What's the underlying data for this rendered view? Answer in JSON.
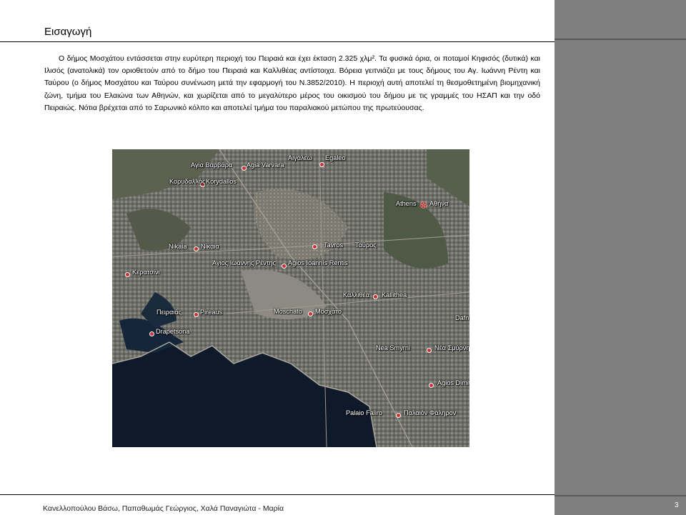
{
  "title": "Εισαγωγή",
  "intro_text": "Ο δήμος Μοσχάτου εντάσσεται στην ευρύτερη περιοχή του Πειραιά και έχει έκταση 2.325 χλμ². Τα φυσικά όρια, οι ποταμοί Κηφισός (δυτικά) και Ιλισός (ανατολικά) τον οριοθετούν από το δήμο του Πειραιά και Καλλιθέας αντίστοιχα. Βόρεια γειτνιάζει με τους δήμους του Αγ. Ιωάννη Ρέντη και Ταύρου (ο δήμος Μοσχάτου και Ταύρου συνένωση μετά την εφαρμογή του Ν.3852/2010). Η περιοχή αυτή αποτελεί τη θεσμοθετημένη βιομηχανική ζώνη, τμήμα του Ελαιώνα των Αθηνών, και χωρίζεται από το μεγαλύτερο μέρος του οικισμού του δήμου με τις γραμμές του ΗΣΑΠ και την οδό Πειραιώς. Νότια βρέχεται από το Σαρωνικό κόλπο και αποτελεί τμήμα του παραλιακού μετώπου της πρωτεύουσας.",
  "map": {
    "labels": {
      "aigaleo": "Αιγάλεω",
      "egaleo": "Egaleo",
      "agia_varvara_gr": "Αγία Βαρβάρα",
      "agia_varvara_en": "Agia Varvara",
      "korydallos_gr": "Κορυδαλλός",
      "korydallos_en": "Korydallos",
      "athens_en": "Athens",
      "athens_gr": "Αθήνα",
      "nikaia_en": "Nikaia",
      "nikaia_gr": "Νίκαια",
      "tavros_en": "Tavros",
      "tavros_gr": "Ταύρος",
      "rentis_gr": "Άγιος Ιωάννης Ρέντης",
      "rentis_en": "Agios Ioannis Rentis",
      "keratsini_gr": "Κερατσίνι",
      "kallithea_gr": "Καλλιθέα",
      "kallithea_en": "Kallithea",
      "piraeus_gr": "Πειραιάς",
      "piraeus_en": "Pireaus",
      "moschato_en": "Moschato",
      "moschato_gr": "Μοσχάτο",
      "dafni_partial": "Dafn",
      "drapetsona": "Drapetsona",
      "nea_smyrni_en": "Nea Smyrni",
      "nea_smyrni_gr": "Νέα Σμύρνη",
      "agios_dimitrios": "Agios Dimitrios",
      "palaio_faliro_en": "Palaio Faliro",
      "palaio_faliro_gr": "Παλαιόν Φάληρον"
    }
  },
  "footer": "Κανελλοπούλου Βάσω, Παπαθωμάς Γεώργιος, Χαλά Παναγιώτα - Μαρία",
  "page_number": "3"
}
